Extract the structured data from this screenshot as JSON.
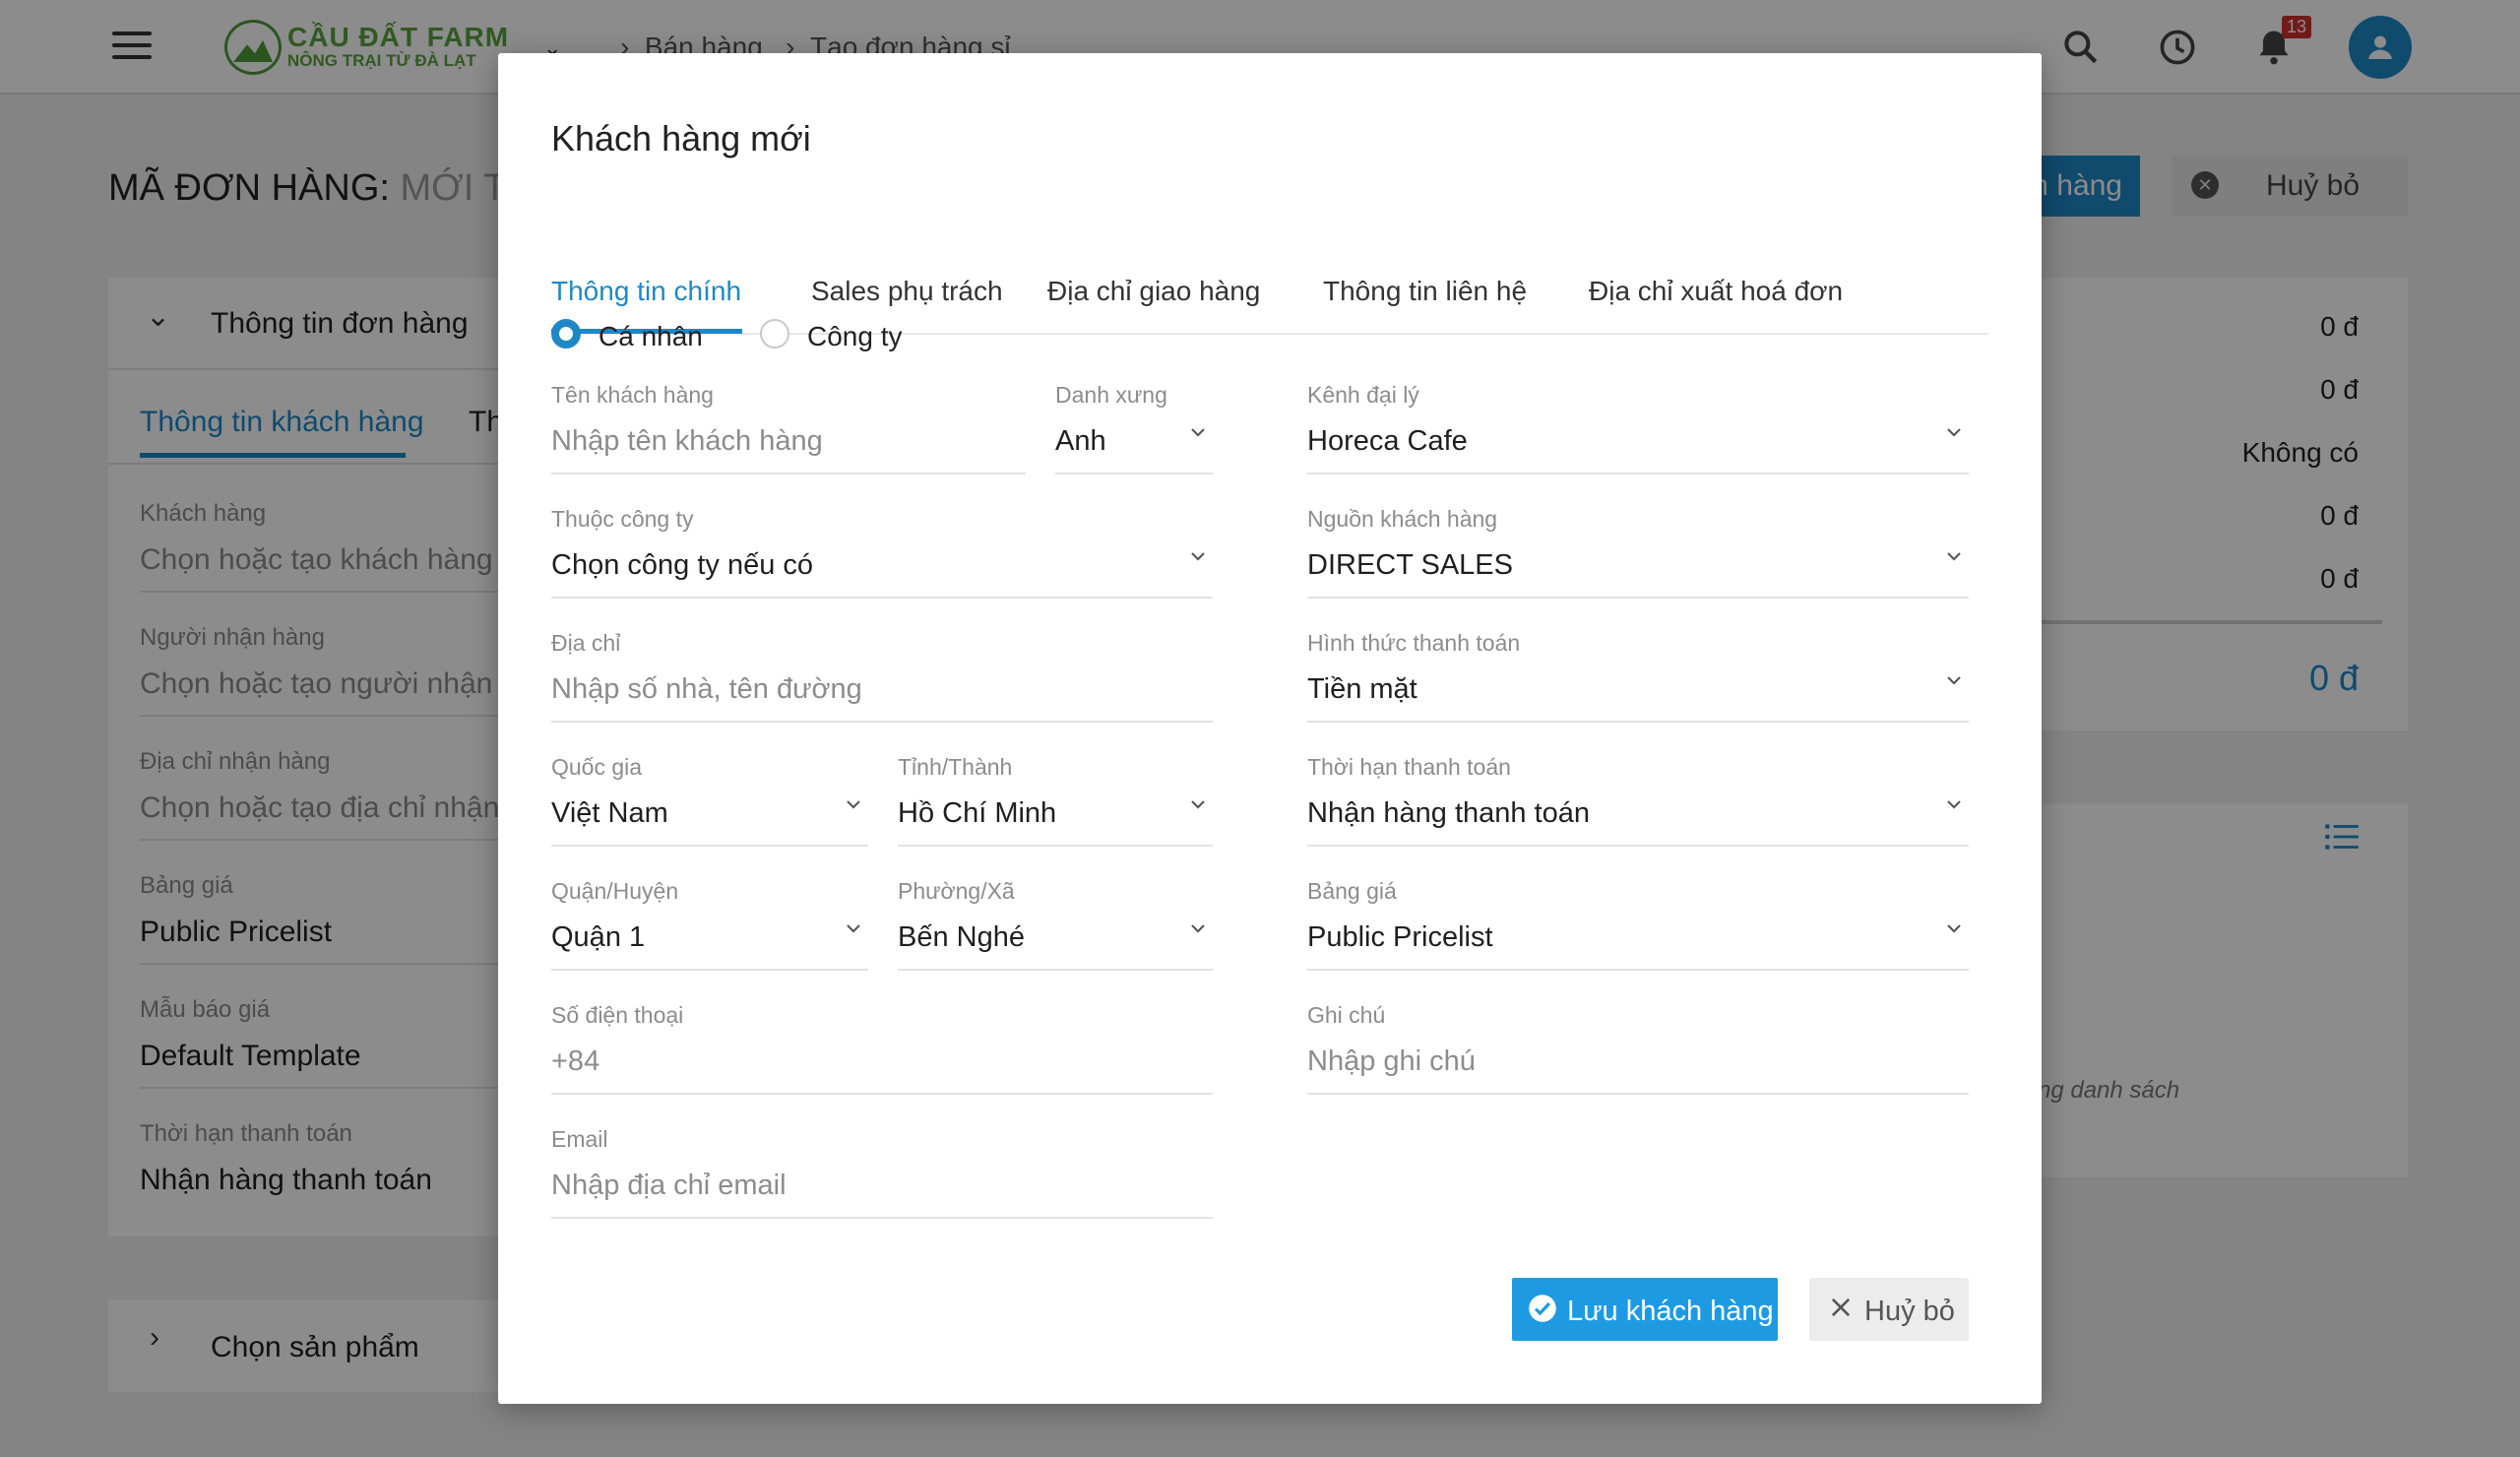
{
  "app": {
    "logo_title": "CẦU ĐẤT FARM",
    "logo_subtitle": "NÔNG TRẠI TỪ ĐÀ LẠT",
    "breadcrumb": [
      "Bán hàng",
      "Tạo đơn hàng sỉ"
    ],
    "notification_count": "13"
  },
  "page": {
    "title_prefix": "MÃ ĐƠN HÀNG:",
    "title_status": "MỚI TẠO",
    "save_button": "n hàng",
    "cancel_button": "Huỷ bỏ"
  },
  "order_panel": {
    "section_title": "Thông tin đơn hàng",
    "tab_active": "Thông tin khách hàng",
    "tab_next": "Th",
    "fields": [
      {
        "label": "Khách hàng",
        "value": "Chọn hoặc tạo khách hàng",
        "placeholder": true
      },
      {
        "label": "Người nhận hàng",
        "value": "Chọn hoặc tạo người nhận hà",
        "placeholder": true
      },
      {
        "label": "Địa chỉ nhận hàng",
        "value": "Chọn hoặc tạo địa chỉ nhận h",
        "placeholder": true
      },
      {
        "label": "Bảng giá",
        "value": "Public Pricelist",
        "placeholder": false
      },
      {
        "label": "Mẫu báo giá",
        "value": "Default Template",
        "placeholder": false
      },
      {
        "label": "Thời hạn thanh toán",
        "value": "Nhận hàng thanh toán",
        "placeholder": false
      }
    ],
    "products_title": "Chọn sản phẩm"
  },
  "summary_panel": {
    "values": [
      "0 đ",
      "0 đ",
      "Không có",
      "0 đ",
      "0 đ"
    ],
    "total": "0 đ",
    "list_hint": "ng danh sách"
  },
  "modal": {
    "title": "Khách hàng mới",
    "tabs": [
      "Thông tin chính",
      "Sales phụ trách",
      "Địa chỉ giao hàng",
      "Thông tin liên hệ",
      "Địa chỉ xuất hoá đơn"
    ],
    "active_tab": "Thông tin chính",
    "customer_type": {
      "options": [
        "Cá nhân",
        "Công ty"
      ],
      "selected": "Cá nhân"
    },
    "fields": {
      "customer_name": {
        "label": "Tên khách hàng",
        "placeholder": "Nhập tên khách hàng"
      },
      "salutation": {
        "label": "Danh xưng",
        "value": "Anh"
      },
      "agent_channel": {
        "label": "Kênh đại lý",
        "value": "Horeca Cafe"
      },
      "company": {
        "label": "Thuộc công ty",
        "value": "Chọn công ty nếu có"
      },
      "customer_source": {
        "label": "Nguồn khách hàng",
        "value": "DIRECT SALES"
      },
      "address": {
        "label": "Địa chỉ",
        "placeholder": "Nhập số nhà, tên đường"
      },
      "payment_method": {
        "label": "Hình thức thanh toán",
        "value": "Tiền mặt"
      },
      "country": {
        "label": "Quốc gia",
        "value": "Việt Nam"
      },
      "province": {
        "label": "Tỉnh/Thành",
        "value": "Hồ Chí Minh"
      },
      "payment_term": {
        "label": "Thời hạn thanh toán",
        "value": "Nhận hàng thanh toán"
      },
      "district": {
        "label": "Quận/Huyện",
        "value": "Quận 1"
      },
      "ward": {
        "label": "Phường/Xã",
        "value": "Bến Nghé"
      },
      "pricelist": {
        "label": "Bảng giá",
        "value": "Public Pricelist"
      },
      "phone": {
        "label": "Số điện thoại",
        "placeholder": "+84"
      },
      "note": {
        "label": "Ghi chú",
        "placeholder": "Nhập ghi chú"
      },
      "email": {
        "label": "Email",
        "placeholder": "Nhập địa chỉ email"
      }
    },
    "save_button": "Lưu khách hàng",
    "cancel_button": "Huỷ bỏ"
  },
  "colors": {
    "accent": "#1e88c7",
    "save_button": "#1e9ae3",
    "logo_green": "#5aa33f",
    "badge_red": "#d0312d"
  },
  "icons": [
    "menu-icon",
    "chevron-down-icon",
    "search-icon",
    "clock-icon",
    "bell-icon",
    "user-icon",
    "close-circle-icon",
    "list-icon",
    "check-circle-icon",
    "close-icon"
  ]
}
